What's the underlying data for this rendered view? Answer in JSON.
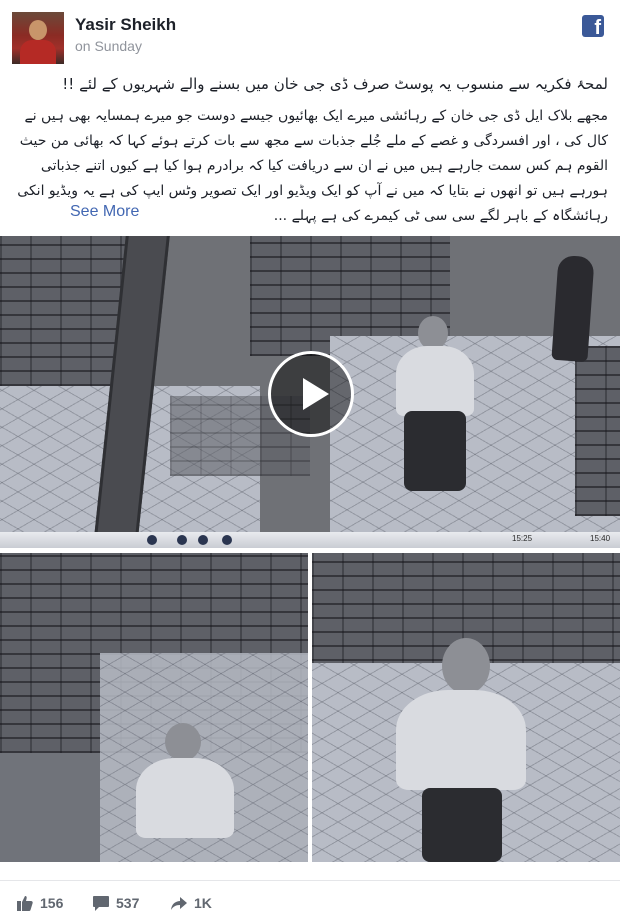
{
  "post": {
    "author": "Yasir Sheikh",
    "timestamp": "on Sunday",
    "brand_icon": "facebook-icon",
    "title": "لمحۂ فکریہ سے منسوب یہ پوسٹ صرف ڈی جی خان میں بسنے والے شہریوں کے لئے !!",
    "body": "مجھے بلاک ایل ڈی جی خان کے رہائشی میرے ایک بھائیوں جیسے دوست جو میرے ہمسایہ بھی ہیں نے کال کی ، اور افسردگی و غصے کے ملے جُلے جذبات سے مجھ سے بات کرتے ہوئے کہا کہ بھائی من حیث القوم ہم کس سمت جارہے ہیں میں نے ان سے دریافت کیا کہ برادرم ہوا کیا ہے کیوں اتنے جذباتی ہورہے ہیں تو انھوں نے بتایا کہ میں نے آپ کو ایک ویڈیو اور ایک تصویر وٹس ایپ کی ہے یہ ویڈیو انکی رہائشگاہ کے باہر لگے سی سی ٹی کیمرے کی ہے پہلے ...",
    "see_more": "See More"
  },
  "media": {
    "video_play_icon": "play-icon",
    "cctv_times": [
      "15:25",
      "15:40"
    ]
  },
  "stats": {
    "likes": "156",
    "comments": "537",
    "shares": "1K"
  },
  "colors": {
    "link": "#4267b2",
    "facebook_blue": "#3b5998",
    "muted": "#90949c"
  }
}
